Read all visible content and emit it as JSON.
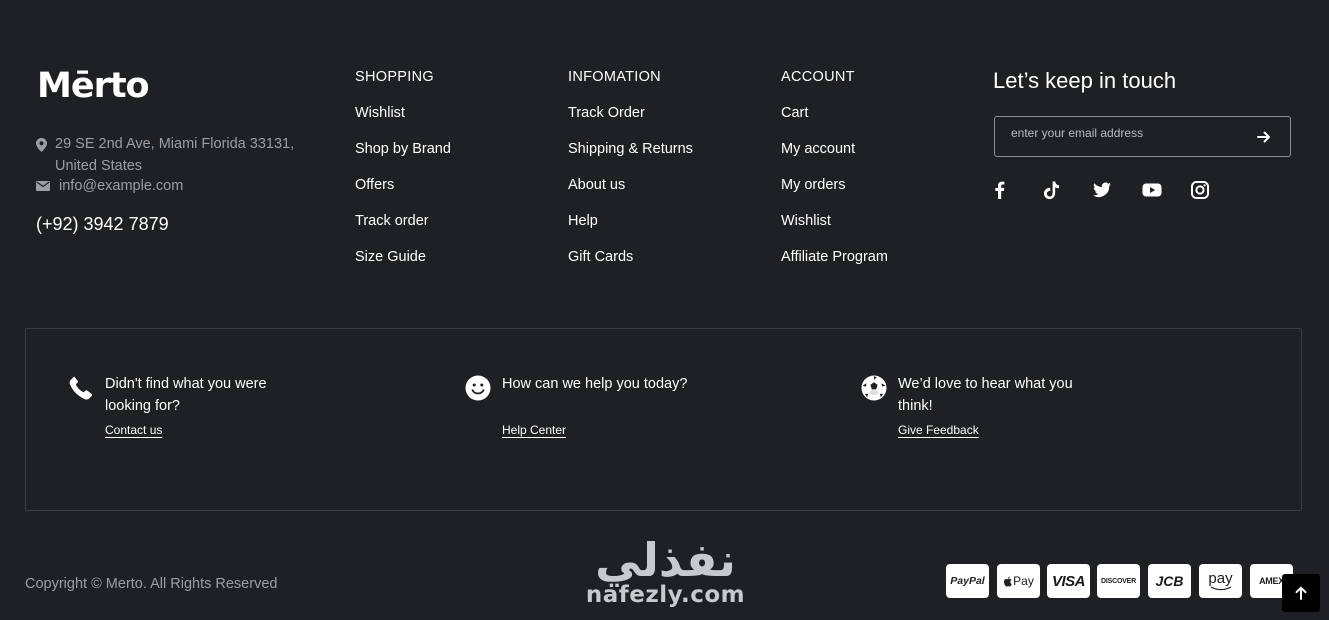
{
  "brand": {
    "logo": "Mērto",
    "address": "29 SE 2nd Ave, Miami Florida 33131, United States",
    "email": "info@example.com",
    "phone": "(+92) 3942 7879"
  },
  "columns": [
    {
      "title": "SHOPPING",
      "links": [
        "Wishlist",
        "Shop by Brand",
        "Offers",
        "Track order",
        "Size Guide"
      ]
    },
    {
      "title": "INFOMATION",
      "links": [
        "Track Order",
        "Shipping & Returns",
        "About us",
        "Help",
        "Gift Cards"
      ]
    },
    {
      "title": "ACCOUNT",
      "links": [
        "Cart",
        "My account",
        "My orders",
        "Wishlist",
        "Affiliate Program"
      ]
    }
  ],
  "newsletter": {
    "title": "Let’s keep in touch",
    "placeholder": "enter your email address",
    "submit_icon": "arrow-right-icon"
  },
  "social": [
    "facebook-icon",
    "tiktok-icon",
    "twitter-icon",
    "youtube-icon",
    "instagram-icon"
  ],
  "help": [
    {
      "icon": "phone-icon",
      "question": "Didn't find what you were looking for?",
      "link": "Contact us"
    },
    {
      "icon": "smile-icon",
      "question": "How can we help you today?",
      "link": "Help Center"
    },
    {
      "icon": "football-icon",
      "question": "We’d love to hear what you think!",
      "link": "Give Feedback"
    }
  ],
  "footer": {
    "copyright": "Copyright © Merto. All Rights Reserved",
    "watermark_ar": "نفذلي",
    "watermark_en": "nafezly.com"
  },
  "payments": [
    "PayPal",
    "Pay",
    "VISA",
    "DISCOVER",
    "JCB",
    "pay",
    "AMEX"
  ],
  "back_to_top_icon": "arrow-up-icon",
  "colors": {
    "background": "#1f2023",
    "accent": "#e0282e",
    "muted_text": "#9c9ea3"
  }
}
